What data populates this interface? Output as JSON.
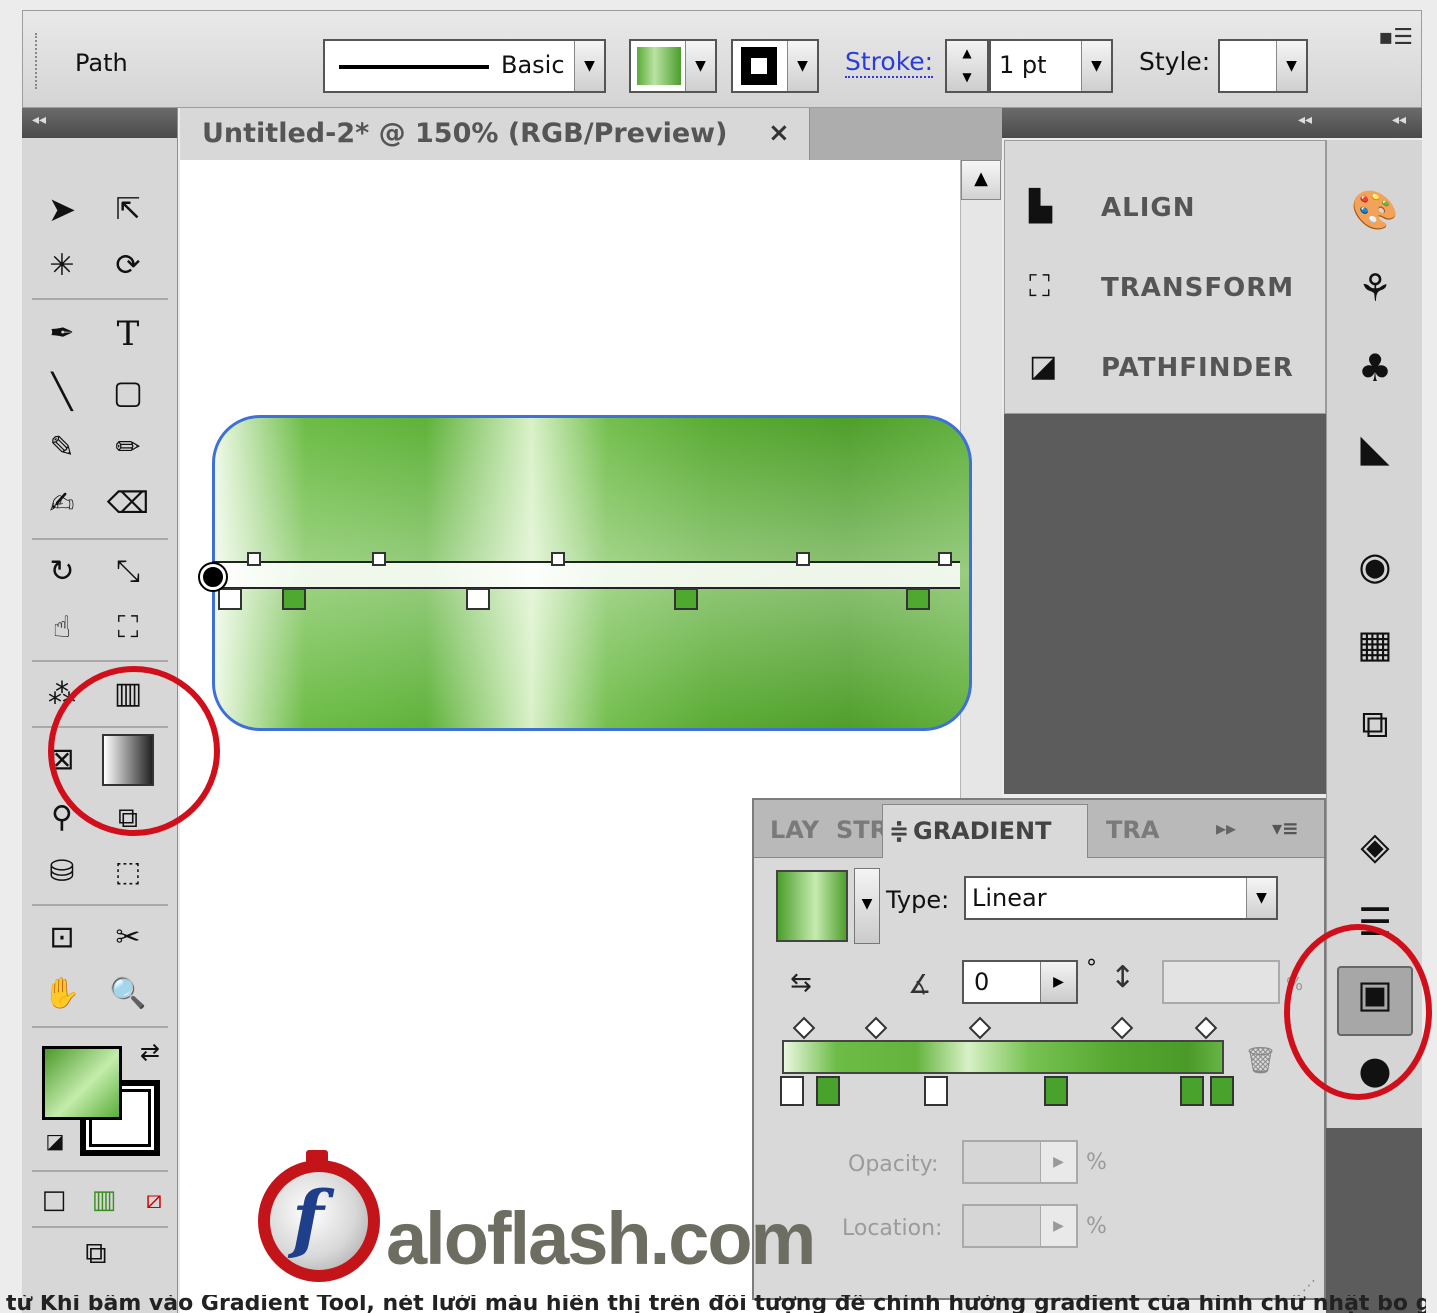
{
  "control_bar": {
    "selection_label": "Path",
    "stroke_profile": "Basic",
    "stroke_label": "Stroke:",
    "stroke_weight": "1 pt",
    "style_label": "Style:",
    "colors": {
      "link_blue": "#2a3cd9",
      "gradient_green": "#5fb23a"
    }
  },
  "document_tab": {
    "title": "Untitled-2* @ 150% (RGB/Preview)",
    "close_glyph": "×"
  },
  "tools_panel": {
    "collapse_glyph": "◂◂",
    "tools": [
      "selection-tool",
      "direct-selection-tool",
      "magic-wand-tool",
      "lasso-tool",
      "pen-tool",
      "type-tool",
      "line-tool",
      "rounded-rectangle-tool",
      "paintbrush-tool",
      "pencil-tool",
      "blob-brush-tool",
      "eraser-tool",
      "rotate-tool",
      "scale-tool",
      "warp-tool",
      "free-transform-tool",
      "symbol-sprayer-tool",
      "column-graph-tool",
      "mesh-tool",
      "gradient-tool",
      "eyedropper-tool",
      "blend-tool",
      "live-paint-bucket-tool",
      "live-paint-selection-tool",
      "artboard-tool",
      "slice-tool",
      "hand-tool",
      "zoom-tool"
    ],
    "type_tool_glyph": "T"
  },
  "dock": {
    "items": [
      {
        "label": "ALIGN",
        "icon": "align-icon"
      },
      {
        "label": "TRANSFORM",
        "icon": "transform-icon"
      },
      {
        "label": "PATHFINDER",
        "icon": "pathfinder-icon"
      }
    ]
  },
  "gradient_panel": {
    "tabs": [
      "LAY",
      "STR",
      "GRADIENT",
      "TRA"
    ],
    "active_tab": "GRADIENT",
    "active_tab_prefix": "≑",
    "type_label": "Type:",
    "type_value": "Linear",
    "angle_value": "0",
    "degree_glyph": "°",
    "aspect_pct": "%",
    "opacity_label": "Opacity:",
    "opacity_pct": "%",
    "location_label": "Location:",
    "location_pct": "%",
    "overflow_glyph": "▸▸",
    "menu_glyph": "▾≡"
  },
  "logo": {
    "letter": "f",
    "text": "aloflash.com"
  },
  "caption": "từ Khi bấm vào Gradient Tool, nét lưới màu hiển thị trên đối tượng để chỉnh hướng gradient của hình chữ nhật bo góc"
}
